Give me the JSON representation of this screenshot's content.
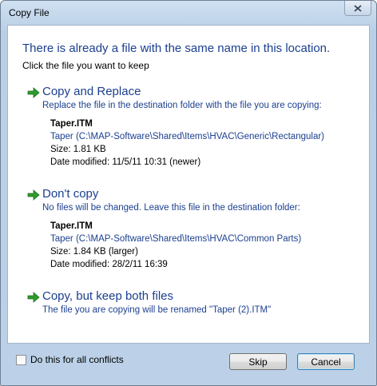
{
  "window": {
    "title": "Copy File"
  },
  "header": {
    "title": "There is already a file with the same name in this location.",
    "subtitle": "Click the file you want to keep"
  },
  "options": [
    {
      "title": "Copy and Replace",
      "description": "Replace the file in the destination folder with the file you are copying:",
      "icon": "green-arrow-icon",
      "file": {
        "name": "Taper.ITM",
        "path": "Taper (C:\\MAP-Software\\Shared\\Items\\HVAC\\Generic\\Rectangular)",
        "size": "Size: 1.81 KB",
        "modified": "Date modified: 11/5/11 10:31 (newer)"
      }
    },
    {
      "title": "Don't copy",
      "description": "No files will be changed. Leave this file in the destination folder:",
      "icon": "green-arrow-icon",
      "file": {
        "name": "Taper.ITM",
        "path": "Taper (C:\\MAP-Software\\Shared\\Items\\HVAC\\Common Parts)",
        "size": "Size: 1.84 KB (larger)",
        "modified": "Date modified: 28/2/11 16:39"
      }
    },
    {
      "title": "Copy, but keep both files",
      "description": "The file you are copying will be renamed \"Taper (2).ITM\"",
      "icon": "green-arrow-icon"
    }
  ],
  "footer": {
    "checkbox_label": "Do this for all conflicts",
    "checkbox_checked": false,
    "skip_label": "Skip",
    "cancel_label": "Cancel"
  },
  "colors": {
    "heading_blue": "#1b3f8f",
    "arrow_green": "#2e9b2e"
  }
}
